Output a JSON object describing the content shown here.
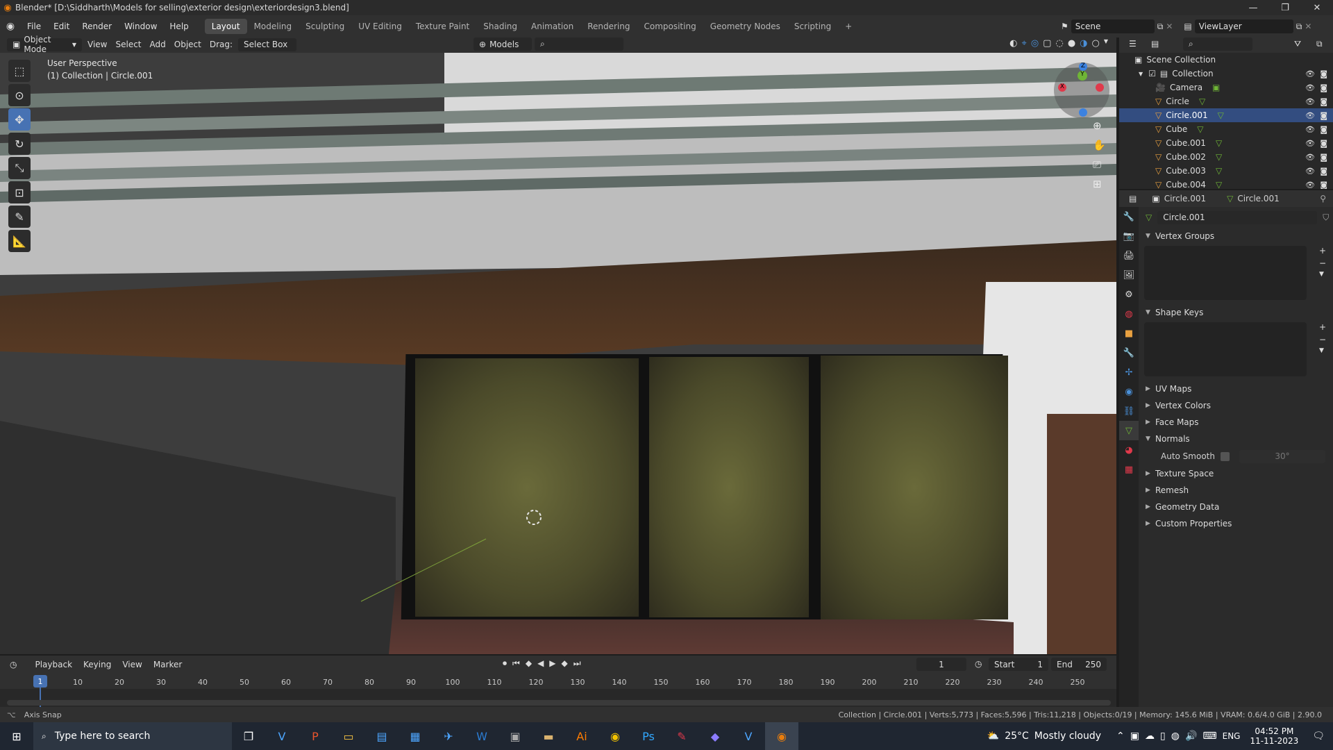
{
  "window": {
    "title": "Blender* [D:\\Siddharth\\Models for selling\\exterior design\\exteriordesign3.blend]",
    "controls": [
      "minimize-icon",
      "maximize-icon",
      "close-icon"
    ]
  },
  "menubar": {
    "menus": [
      "File",
      "Edit",
      "Render",
      "Window",
      "Help"
    ],
    "workspaces": [
      "Layout",
      "Modeling",
      "Sculpting",
      "UV Editing",
      "Texture Paint",
      "Shading",
      "Animation",
      "Rendering",
      "Compositing",
      "Geometry Nodes",
      "Scripting"
    ],
    "active_workspace": "Layout",
    "scene": "Scene",
    "view_layer": "ViewLayer"
  },
  "viewport_header": {
    "mode": "Object Mode",
    "menus": [
      "View",
      "Select",
      "Add",
      "Object"
    ],
    "drag_label": "Drag:",
    "drag_value": "Select Box",
    "orientation": "Models"
  },
  "viewport": {
    "perspective": "User Perspective",
    "collection_info": "(1) Collection | Circle.001",
    "tools": [
      "select-box-icon",
      "cursor-icon",
      "move-icon",
      "rotate-icon",
      "scale-icon",
      "transform-icon",
      "annotate-icon",
      "measure-icon"
    ],
    "active_tool": "move-icon",
    "gizmo_axes": [
      "X",
      "Y",
      "Z"
    ]
  },
  "outliner": {
    "root": "Scene Collection",
    "collection": "Collection",
    "items": [
      {
        "name": "Camera",
        "type": "camera"
      },
      {
        "name": "Circle",
        "type": "mesh"
      },
      {
        "name": "Circle.001",
        "type": "mesh"
      },
      {
        "name": "Cube",
        "type": "mesh"
      },
      {
        "name": "Cube.001",
        "type": "mesh"
      },
      {
        "name": "Cube.002",
        "type": "mesh"
      },
      {
        "name": "Cube.003",
        "type": "mesh"
      },
      {
        "name": "Cube.004",
        "type": "mesh"
      }
    ]
  },
  "properties": {
    "object_name": "Circle.001",
    "data_name": "Circle.001",
    "mesh_name": "Circle.001",
    "panels": [
      {
        "label": "Vertex Groups",
        "open": true
      },
      {
        "label": "Shape Keys",
        "open": true
      },
      {
        "label": "UV Maps",
        "open": false
      },
      {
        "label": "Vertex Colors",
        "open": false
      },
      {
        "label": "Face Maps",
        "open": false
      },
      {
        "label": "Normals",
        "open": true
      },
      {
        "label": "Texture Space",
        "open": false
      },
      {
        "label": "Remesh",
        "open": false
      },
      {
        "label": "Geometry Data",
        "open": false
      },
      {
        "label": "Custom Properties",
        "open": false
      }
    ],
    "auto_smooth_label": "Auto Smooth",
    "auto_smooth_angle": "30°"
  },
  "timeline": {
    "menus": [
      "Playback",
      "Keying",
      "View",
      "Marker"
    ],
    "current_frame": "1",
    "start_label": "Start",
    "start": "1",
    "end_label": "End",
    "end": "250",
    "ticks": [
      "10",
      "20",
      "30",
      "40",
      "50",
      "60",
      "70",
      "80",
      "90",
      "100",
      "110",
      "120",
      "130",
      "140",
      "150",
      "160",
      "170",
      "180",
      "190",
      "200",
      "210",
      "220",
      "230",
      "240",
      "250"
    ],
    "playhead": "1"
  },
  "statusbar": {
    "left": "Axis Snap",
    "right": "Collection | Circle.001 | Verts:5,773 | Faces:5,596 | Tris:11,218 | Objects:0/19 | Memory: 145.6 MiB | VRAM: 0.6/4.0 GiB | 2.90.0"
  },
  "taskbar": {
    "search_placeholder": "Type here to search",
    "weather_temp": "25°C",
    "weather_text": "Mostly cloudy",
    "lang": "ENG",
    "time": "04:52 PM",
    "date": "11-11-2023"
  },
  "colors": {
    "accent": "#4772b3",
    "blender_orange": "#e87d0d",
    "x_axis": "#e0394b",
    "y_axis": "#6fb536",
    "z_axis": "#3c82e0"
  }
}
